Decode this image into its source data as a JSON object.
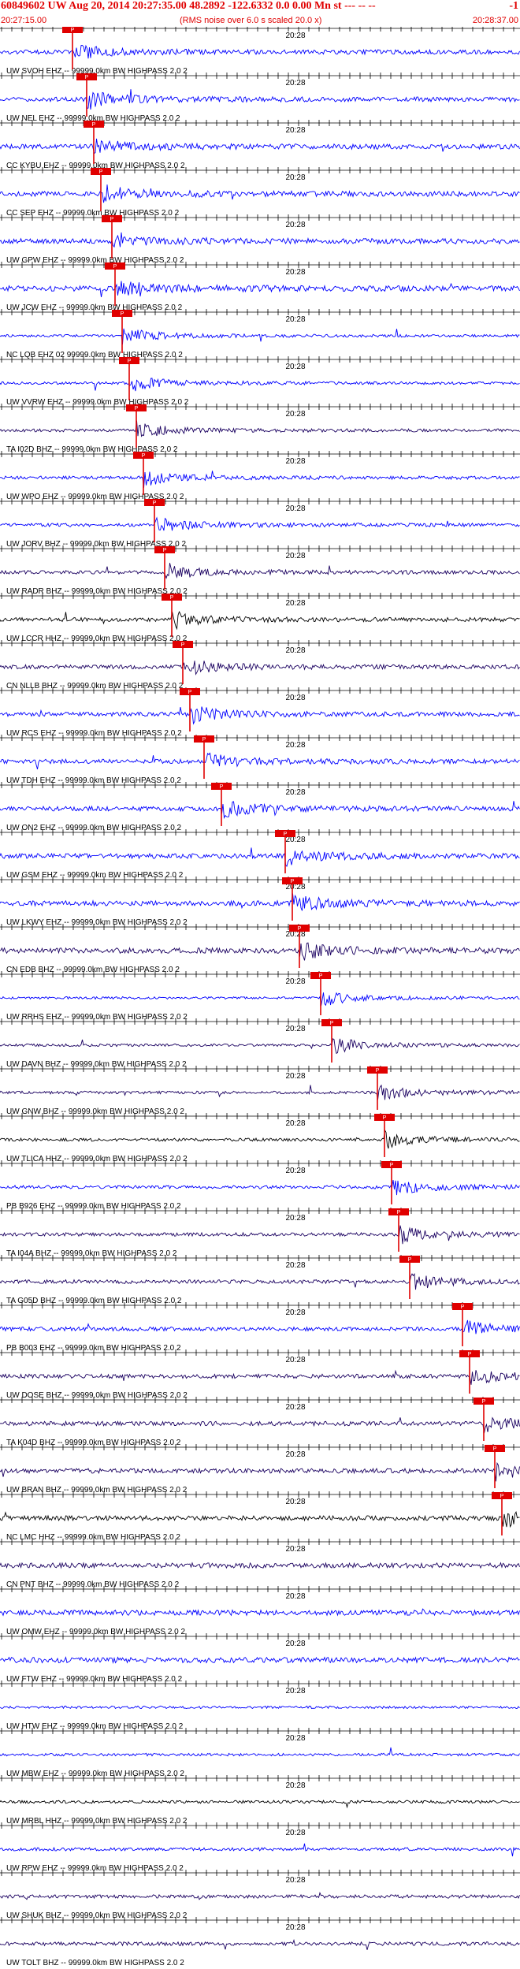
{
  "header": {
    "title": "60849602 UW Aug 20, 2014 20:27:35.00   48.2892  -122.6332   0.0  0.00 Mn st --- -- --",
    "title_right": "-1",
    "start_time": "20:27:15.00",
    "note": "(RMS noise over 6.0 s scaled 20.0 x)",
    "end_time": "20:28:37.00"
  },
  "chart_data": {
    "type": "seismogram-record-section",
    "time_start": "20:27:15.00",
    "time_end": "20:28:37.00",
    "minute_label": "20:28",
    "pick_label": "P",
    "traces": [
      {
        "label": "UW SVOH EHZ -- 99999.0km BW HIGHPASS  2.0  2",
        "color": "#0000ff",
        "pick": 20.5
      },
      {
        "label": "UW NEL EHZ -- 99999.0km BW HIGHPASS  2.0  2",
        "color": "#0000ff",
        "pick": 24.5
      },
      {
        "label": "CC KYBU EHZ -- 99999.0km BW HIGHPASS  2.0  2",
        "color": "#0000ff",
        "pick": 26.5
      },
      {
        "label": "CC SEP EHZ -- 99999.0km BW HIGHPASS  2.0  2",
        "color": "#0000ff",
        "pick": 28.5
      },
      {
        "label": "UW GPW EHZ -- 99999.0km BW HIGHPASS  2.0  2",
        "color": "#0000ff",
        "pick": 31.5
      },
      {
        "label": "UW JCW EHZ -- 99999.0km BW HIGHPASS  2.0  2",
        "color": "#0000ff",
        "pick": 32.5
      },
      {
        "label": "NC LQB EHZ 02 99999.0km BW HIGHPASS  2.0  2",
        "color": "#0000ff",
        "pick": 34.5
      },
      {
        "label": "UW VVRW EHZ -- 99999.0km BW HIGHPASS  2.0  2",
        "color": "#0000ff",
        "pick": 36.5
      },
      {
        "label": "TA I02D BHZ -- 99999.0km BW HIGHPASS  2.0  2",
        "color": "#1a0060",
        "pick": 38.5
      },
      {
        "label": "UW WPO EHZ -- 99999.0km BW HIGHPASS  2.0  2",
        "color": "#0000ff",
        "pick": 40.5
      },
      {
        "label": "UW JORV BHZ -- 99999.0km BW HIGHPASS  2.0  2",
        "color": "#0000ff",
        "pick": 43.5
      },
      {
        "label": "UW RADR BHZ -- 99999.0km BW HIGHPASS  2.0  2",
        "color": "#1a0060",
        "pick": 46.5
      },
      {
        "label": "UW LCCR HHZ -- 99999.0km BW HIGHPASS  2.0  2",
        "color": "#000000",
        "pick": 48.5
      },
      {
        "label": "CN NLLB BHZ -- 99999.0km BW HIGHPASS  2.0  2",
        "color": "#1a0060",
        "pick": 51.5
      },
      {
        "label": "UW RCS EHZ -- 99999.0km BW HIGHPASS  2.0  2",
        "color": "#0000ff",
        "pick": 53.5
      },
      {
        "label": "UW TDH EHZ -- 99999.0km BW HIGHPASS  2.0  2",
        "color": "#0000ff",
        "pick": 57.5
      },
      {
        "label": "UW ON2 EHZ -- 99999.0km BW HIGHPASS  2.0  2",
        "color": "#0000ff",
        "pick": 62.5
      },
      {
        "label": "UW GSM EHZ -- 99999.0km BW HIGHPASS  2.0  2",
        "color": "#0000ff",
        "pick": 80.5
      },
      {
        "label": "UW LKWY EHZ -- 99999.0km BW HIGHPASS  2.0  2",
        "color": "#0000ff",
        "pick": 82.5
      },
      {
        "label": "CN EDB BHZ -- 99999.0km BW HIGHPASS  2.0  2",
        "color": "#1a0060",
        "pick": 84.5
      },
      {
        "label": "UW RRHS EHZ -- 99999.0km BW HIGHPASS  2.0  2",
        "color": "#0000ff",
        "pick": 90.5
      },
      {
        "label": "UW DAVN BHZ -- 99999.0km BW HIGHPASS  2.0  2",
        "color": "#1a0060",
        "pick": 93.5
      },
      {
        "label": "UW GNW BHZ -- 99999.0km BW HIGHPASS  2.0  2",
        "color": "#1a0060",
        "pick": 106.5
      },
      {
        "label": "UW TLICA HHZ -- 99999.0km BW HIGHPASS  2.0  2",
        "color": "#000000",
        "pick": 108.5
      },
      {
        "label": "PB B926 EHZ -- 99999.0km BW HIGHPASS  2.0  2",
        "color": "#0000ff",
        "pick": 110.5
      },
      {
        "label": "TA I04A BHZ -- 99999.0km BW HIGHPASS  2.0  2",
        "color": "#1a0060",
        "pick": 112.5
      },
      {
        "label": "TA G05D BHZ -- 99999.0km BW HIGHPASS  2.0  2",
        "color": "#1a0060",
        "pick": 115.5
      },
      {
        "label": "PB B003 EHZ -- 99999.0km BW HIGHPASS  2.0  2",
        "color": "#0000ff",
        "pick": 130.5
      },
      {
        "label": "UW DOSE BHZ -- 99999.0km BW HIGHPASS  2.0  2",
        "color": "#1a0060",
        "pick": 132.5
      },
      {
        "label": "TA K04D BHZ -- 99999.0km BW HIGHPASS  2.0  2",
        "color": "#1a0060",
        "pick": 136.5
      },
      {
        "label": "UW BRAN BHZ -- 99999.0km BW HIGHPASS  2.0  2",
        "color": "#1a0060",
        "pick": 139.5
      },
      {
        "label": "NC LMC HHZ -- 99999.0km BW HIGHPASS  2.0  2",
        "color": "#000000",
        "pick": 141.5
      },
      {
        "label": "CN PNT BHZ -- 99999.0km BW HIGHPASS  2.0  2",
        "color": "#1a0060",
        "pick": null
      },
      {
        "label": "UW OMW EHZ -- 99999.0km BW HIGHPASS  2.0  2",
        "color": "#0000ff",
        "pick": null
      },
      {
        "label": "UW FTW EHZ -- 99999.0km BW HIGHPASS  2.0  2",
        "color": "#0000ff",
        "pick": null
      },
      {
        "label": "UW HTW EHZ -- 99999.0km BW HIGHPASS  2.0  2",
        "color": "#0000ff",
        "pick": null
      },
      {
        "label": "UW MBW EHZ -- 99999.0km BW HIGHPASS  2.0  2",
        "color": "#0000ff",
        "pick": null
      },
      {
        "label": "UW MRBL HHZ -- 99999.0km BW HIGHPASS  2.0  2",
        "color": "#000000",
        "pick": null
      },
      {
        "label": "UW RPW EHZ -- 99999.0km BW HIGHPASS  2.0  2",
        "color": "#0000ff",
        "pick": null
      },
      {
        "label": "UW SHUK BHZ -- 99999.0km BW HIGHPASS  2.0  2",
        "color": "#1a0060",
        "pick": null
      },
      {
        "label": "UW TOLT BHZ -- 99999.0km BW HIGHPASS  2.0  2",
        "color": "#1a0060",
        "pick": null
      }
    ]
  }
}
